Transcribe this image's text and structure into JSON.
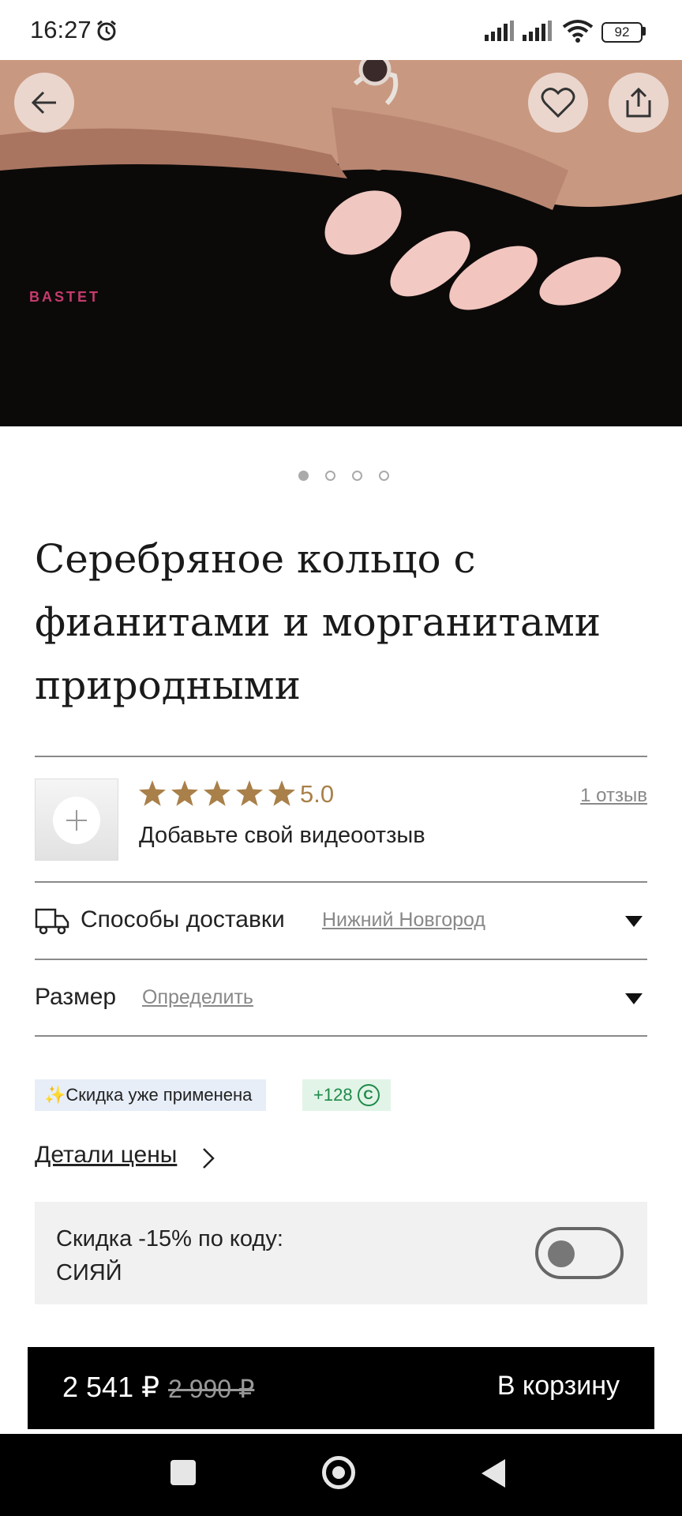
{
  "status_bar": {
    "time": "16:27",
    "battery": "92",
    "icons": [
      "alarm-icon",
      "signal-icon",
      "signal-icon",
      "wifi-icon",
      "battery-icon"
    ]
  },
  "hero": {
    "brand": "BASTET",
    "icons": [
      "back-arrow-icon",
      "heart-icon",
      "share-icon"
    ],
    "carousel_total": 4,
    "carousel_active": 1
  },
  "product": {
    "title": "Серебряное кольцо с фианитами и морганитами природными"
  },
  "reviews": {
    "rating_value": 5,
    "rating_max": 5,
    "rating_text": "5.0",
    "count_link": "1 отзыв",
    "add_video": "Добавьте свой видеоотзыв",
    "star_color": "#a9804a"
  },
  "delivery": {
    "label": "Способы доставки",
    "city": "Нижний Новгород"
  },
  "size": {
    "label": "Размер",
    "action": "Определить"
  },
  "badges": {
    "discount": "✨Скидка уже применена",
    "bonus": "+128",
    "bonus_coin": "C",
    "discount_bg": "#e7eef8",
    "bonus_bg": "#e2f4e7",
    "bonus_color": "#1f8a4a"
  },
  "price_details": {
    "label": "Детали цены"
  },
  "promo": {
    "line1": "Скидка -15% по коду:",
    "line2": "СИЯЙ",
    "toggle_on": false
  },
  "cart": {
    "price": "2 541 ₽",
    "old_price": "2 990 ₽",
    "button": "В корзину"
  },
  "nav": {
    "icons": [
      "recent-apps-icon",
      "home-icon",
      "back-icon"
    ]
  }
}
